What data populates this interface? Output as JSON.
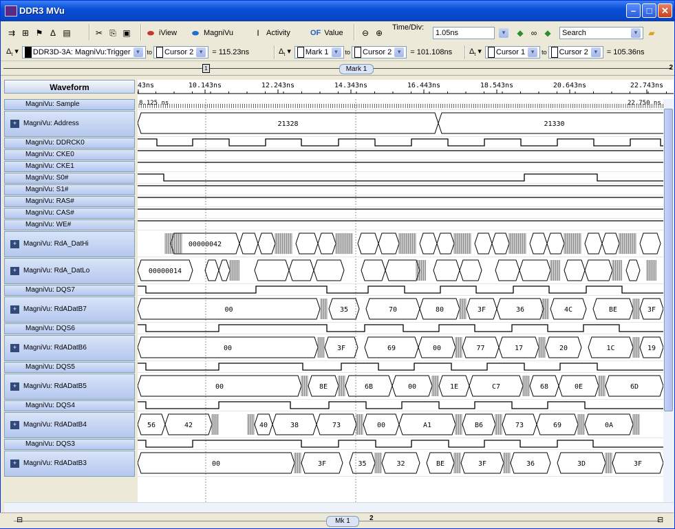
{
  "window": {
    "title": "DDR3 MVu"
  },
  "toolbar": {
    "iview": "iView",
    "magnivu": "MagniVu",
    "activity": "Activity",
    "of_icon_text": "OF",
    "of_value": "Value",
    "time_div_label": "Time/Div:",
    "time_div_value": "1.05ns",
    "search": "Search"
  },
  "measurements": [
    {
      "signal": "DDR3D-3A: MagniVu:Trigger",
      "to": "to",
      "target": "Cursor 2",
      "result": "= 115.23ns"
    },
    {
      "signal": "Mark 1",
      "to": "to",
      "target": "Cursor 2",
      "result": "= 101.108ns"
    },
    {
      "signal": "Cursor 1",
      "to": "to",
      "target": "Cursor 2",
      "result": "= 105.36ns"
    }
  ],
  "ruler": {
    "mark": "Mark 1",
    "marker_box": "1",
    "page": "2"
  },
  "header": {
    "waveform": "Waveform"
  },
  "time_ticks": [
    "43ns",
    "10.143ns",
    "12.243ns",
    "14.343ns",
    "16.443ns",
    "18.543ns",
    "20.643ns",
    "22.743ns"
  ],
  "sample_labels": {
    "start": "8.125 ns",
    "end": "22.750 ns"
  },
  "signals": [
    {
      "label": "MagniVu: Sample",
      "expand": false
    },
    {
      "label": "MagniVu: Address",
      "expand": true
    },
    {
      "label": "MagniVu: DDRCK0",
      "expand": false
    },
    {
      "label": "MagniVu: CKE0",
      "expand": false
    },
    {
      "label": "MagniVu: CKE1",
      "expand": false
    },
    {
      "label": "MagniVu: S0#",
      "expand": false
    },
    {
      "label": "MagniVu: S1#",
      "expand": false
    },
    {
      "label": "MagniVu: RAS#",
      "expand": false
    },
    {
      "label": "MagniVu: CAS#",
      "expand": false
    },
    {
      "label": "MagniVu: WE#",
      "expand": false
    },
    {
      "label": "MagniVu: RdA_DatHi",
      "expand": true
    },
    {
      "label": "MagniVu: RdA_DatLo",
      "expand": true
    },
    {
      "label": "MagniVu: DQS7",
      "expand": false
    },
    {
      "label": "MagniVu: RdADatB7",
      "expand": true
    },
    {
      "label": "MagniVu: DQS6",
      "expand": false
    },
    {
      "label": "MagniVu: RdADatB6",
      "expand": true
    },
    {
      "label": "MagniVu: DQS5",
      "expand": false
    },
    {
      "label": "MagniVu: RdADatB5",
      "expand": true
    },
    {
      "label": "MagniVu: DQS4",
      "expand": false
    },
    {
      "label": "MagniVu: RdADatB4",
      "expand": true
    },
    {
      "label": "MagniVu: DQS3",
      "expand": false
    },
    {
      "label": "MagniVu: RdADatB3",
      "expand": true
    }
  ],
  "bus_values": {
    "address": [
      "21328",
      "21330"
    ],
    "rda_dathi": [
      "00000042"
    ],
    "rda_datlo": [
      "00000014"
    ],
    "b7": [
      "00",
      "35",
      "70",
      "80",
      "3F",
      "36",
      "4C",
      "BE",
      "3F"
    ],
    "b6": [
      "00",
      "3F",
      "69",
      "00",
      "77",
      "17",
      "20",
      "1C",
      "19"
    ],
    "b5": [
      "00",
      "8E",
      "6B",
      "00",
      "1E",
      "C7",
      "68",
      "0E",
      "6D"
    ],
    "b4": [
      "56",
      "42",
      "40",
      "38",
      "73",
      "00",
      "A1",
      "B6",
      "73",
      "69",
      "0A"
    ],
    "b3": [
      "00",
      "3F",
      "35",
      "32",
      "BE",
      "3F",
      "36",
      "3D",
      "3F"
    ]
  },
  "bottom": {
    "pill": "Mk 1",
    "page": "2"
  }
}
